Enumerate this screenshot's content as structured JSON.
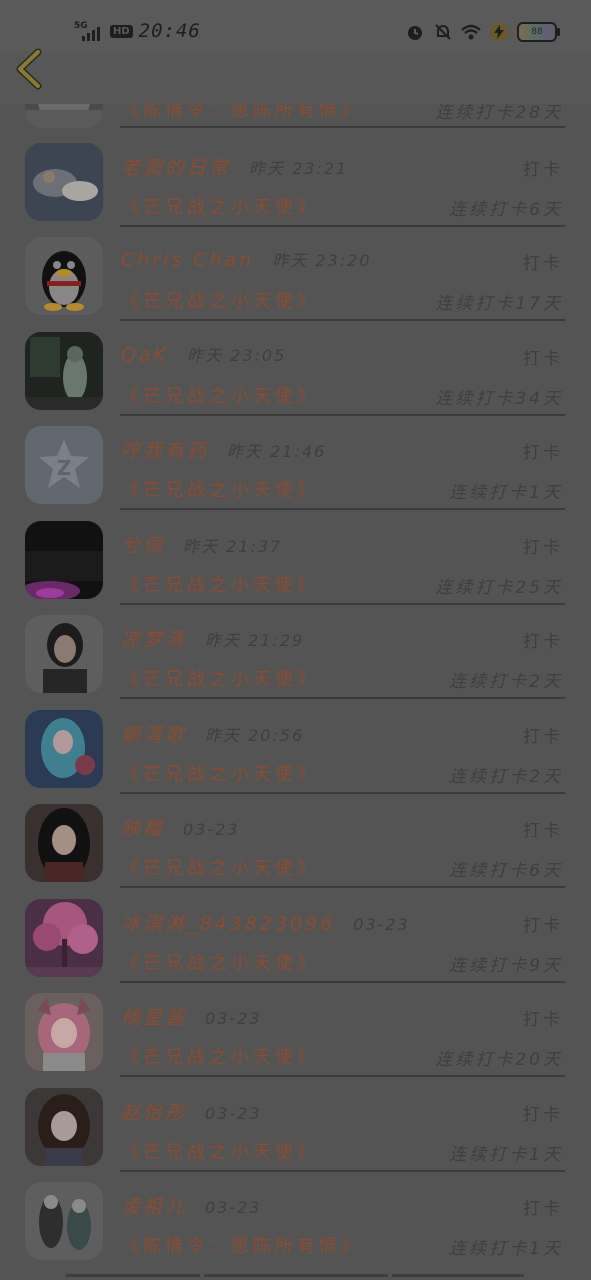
{
  "status_bar": {
    "network": "5G",
    "hd": "HD",
    "time": "20:46",
    "battery": "88",
    "icons": [
      "alarm-icon",
      "mute-bell-icon",
      "wifi-icon",
      "charging-icon",
      "battery-icon"
    ]
  },
  "nav": {
    "back_icon": "back-chevron-icon"
  },
  "colors": {
    "name": "#8a4c33",
    "meta": "#3f3f3f",
    "background": "#545454",
    "divider": "#3a3a3a"
  },
  "rows": [
    {
      "name": "",
      "time": "",
      "label": "",
      "book": "《陈情令：愿陈所有情》",
      "streak": "连续打卡28天",
      "avatar": "partial-avatar"
    },
    {
      "name": "老窦的日常",
      "time": "昨天 23:21",
      "label": "打卡",
      "book": "《芒兄战之小天使》",
      "streak": "连续打卡6天",
      "avatar": "cat-photo"
    },
    {
      "name": "Chris Chan",
      "time": "昨天 23:20",
      "label": "打卡",
      "book": "《芒兄战之小天使》",
      "streak": "连续打卡17天",
      "avatar": "penguin"
    },
    {
      "name": "QaK",
      "time": "昨天 23:05",
      "label": "打卡",
      "book": "《芒兄战之小天使》",
      "streak": "连续打卡34天",
      "avatar": "night-scene"
    },
    {
      "name": "哼我有药",
      "time": "昨天 21:46",
      "label": "打卡",
      "book": "《芒兄战之小天使》",
      "streak": "连续打卡1天",
      "avatar": "default-star"
    },
    {
      "name": "兮佩",
      "time": "昨天 21:37",
      "label": "打卡",
      "book": "《芒兄战之小天使》",
      "streak": "连续打卡25天",
      "avatar": "dark-room"
    },
    {
      "name": "凉梦清",
      "time": "昨天 21:29",
      "label": "打卡",
      "book": "《芒兄战之小天使》",
      "streak": "连续打卡2天",
      "avatar": "girl-photo"
    },
    {
      "name": "顧清歌",
      "time": "昨天 20:56",
      "label": "打卡",
      "book": "《芒兄战之小天使》",
      "streak": "连续打卡2天",
      "avatar": "anime-blue"
    },
    {
      "name": "映樱",
      "time": "03-23",
      "label": "打卡",
      "book": "《芒兄战之小天使》",
      "streak": "连续打卡6天",
      "avatar": "anime-dark-hair"
    },
    {
      "name": "冰淇淋_843823096",
      "time": "03-23",
      "label": "打卡",
      "book": "《芒兄战之小天使》",
      "streak": "连续打卡9天",
      "avatar": "pink-tree"
    },
    {
      "name": "楠星酱",
      "time": "03-23",
      "label": "打卡",
      "book": "《芒兄战之小天使》",
      "streak": "连续打卡20天",
      "avatar": "anime-pink-cat"
    },
    {
      "name": "赵怡彤",
      "time": "03-23",
      "label": "打卡",
      "book": "《芒兄战之小天使》",
      "streak": "连续打卡1天",
      "avatar": "anime-brown"
    },
    {
      "name": "凌祖儿",
      "time": "03-23",
      "label": "打卡",
      "book": "《陈情令：愿陈所有情》",
      "streak": "连续打卡1天",
      "avatar": "ink-figures"
    }
  ]
}
